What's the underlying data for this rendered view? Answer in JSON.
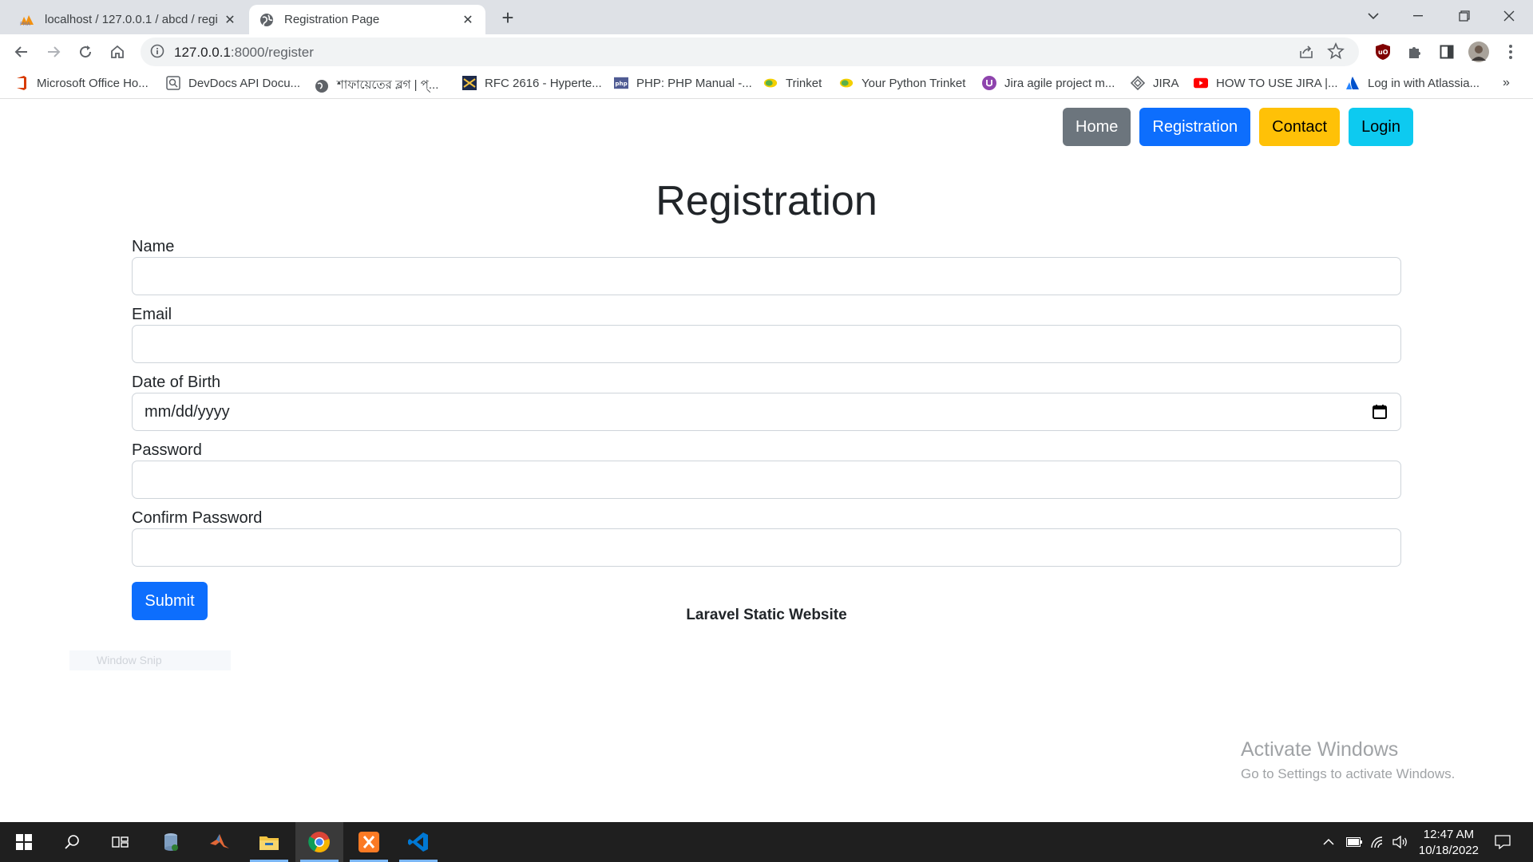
{
  "browser": {
    "tabs": [
      {
        "title": "localhost / 127.0.0.1 / abcd / regi",
        "active": false
      },
      {
        "title": "Registration Page",
        "active": true
      }
    ],
    "url_host": "127.0.0.1",
    "url_path": ":8000/register"
  },
  "bookmarks": [
    {
      "label": "Microsoft Office Ho...",
      "icon": "office-icon"
    },
    {
      "label": "DevDocs API Docu...",
      "icon": "devdocs-icon"
    },
    {
      "label": "শাফায়েতের ব্লগ | প্...",
      "icon": "globe-icon"
    },
    {
      "label": "RFC 2616 - Hyperte...",
      "icon": "rfc-icon"
    },
    {
      "label": "PHP: PHP Manual -...",
      "icon": "php-icon"
    },
    {
      "label": "Trinket",
      "icon": "trinket-icon"
    },
    {
      "label": "Your Python Trinket",
      "icon": "trinket-icon"
    },
    {
      "label": "Jira agile project m...",
      "icon": "jira-icon"
    },
    {
      "label": "JIRA",
      "icon": "jira-diamond-icon"
    },
    {
      "label": "HOW TO USE JIRA |...",
      "icon": "youtube-icon"
    },
    {
      "label": "Log in with Atlassia...",
      "icon": "atlassian-icon"
    }
  ],
  "nav": {
    "home": "Home",
    "registration": "Registration",
    "contact": "Contact",
    "login": "Login"
  },
  "page": {
    "title": "Registration",
    "fields": {
      "name": "Name",
      "email": "Email",
      "dob": "Date of Birth",
      "dob_placeholder": "mm/dd/yyyy",
      "password": "Password",
      "confirm_password": "Confirm Password"
    },
    "submit": "Submit",
    "footer": "Laravel Static Website"
  },
  "overlay": {
    "snip": "Window Snip",
    "activate_title": "Activate Windows",
    "activate_sub": "Go to Settings to activate Windows."
  },
  "taskbar": {
    "time": "12:47 AM",
    "date": "10/18/2022"
  },
  "colors": {
    "primary": "#0d6efd",
    "secondary": "#6c757d",
    "warning": "#ffc107",
    "info": "#0dcaf0"
  }
}
